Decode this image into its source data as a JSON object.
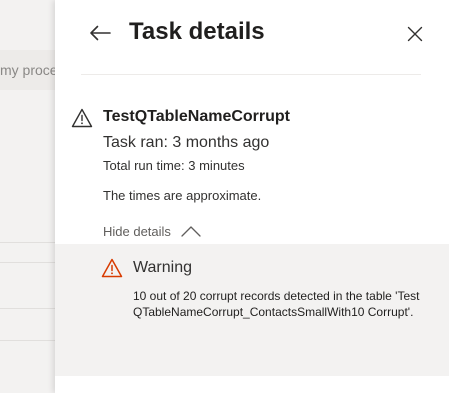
{
  "background": {
    "search_placeholder": "my proce"
  },
  "panel": {
    "title": "Task details",
    "back_icon": "arrow-left-icon",
    "close_icon": "close-icon"
  },
  "task": {
    "status_icon": "warning-icon",
    "name": "TestQTableNameCorrupt",
    "ran": "Task ran: 3 months ago",
    "run_time": "Total run time: 3 minutes",
    "note": "The times are approximate.",
    "toggle_label": "Hide details",
    "toggle_icon": "chevron-up-icon"
  },
  "details": {
    "icon": "warning-icon",
    "icon_color": "#d83b01",
    "title": "Warning",
    "message": "10 out of 20 corrupt records detected in the table 'TestQTableNameCorrupt_ContactsSmallWith10 Corrupt'."
  }
}
